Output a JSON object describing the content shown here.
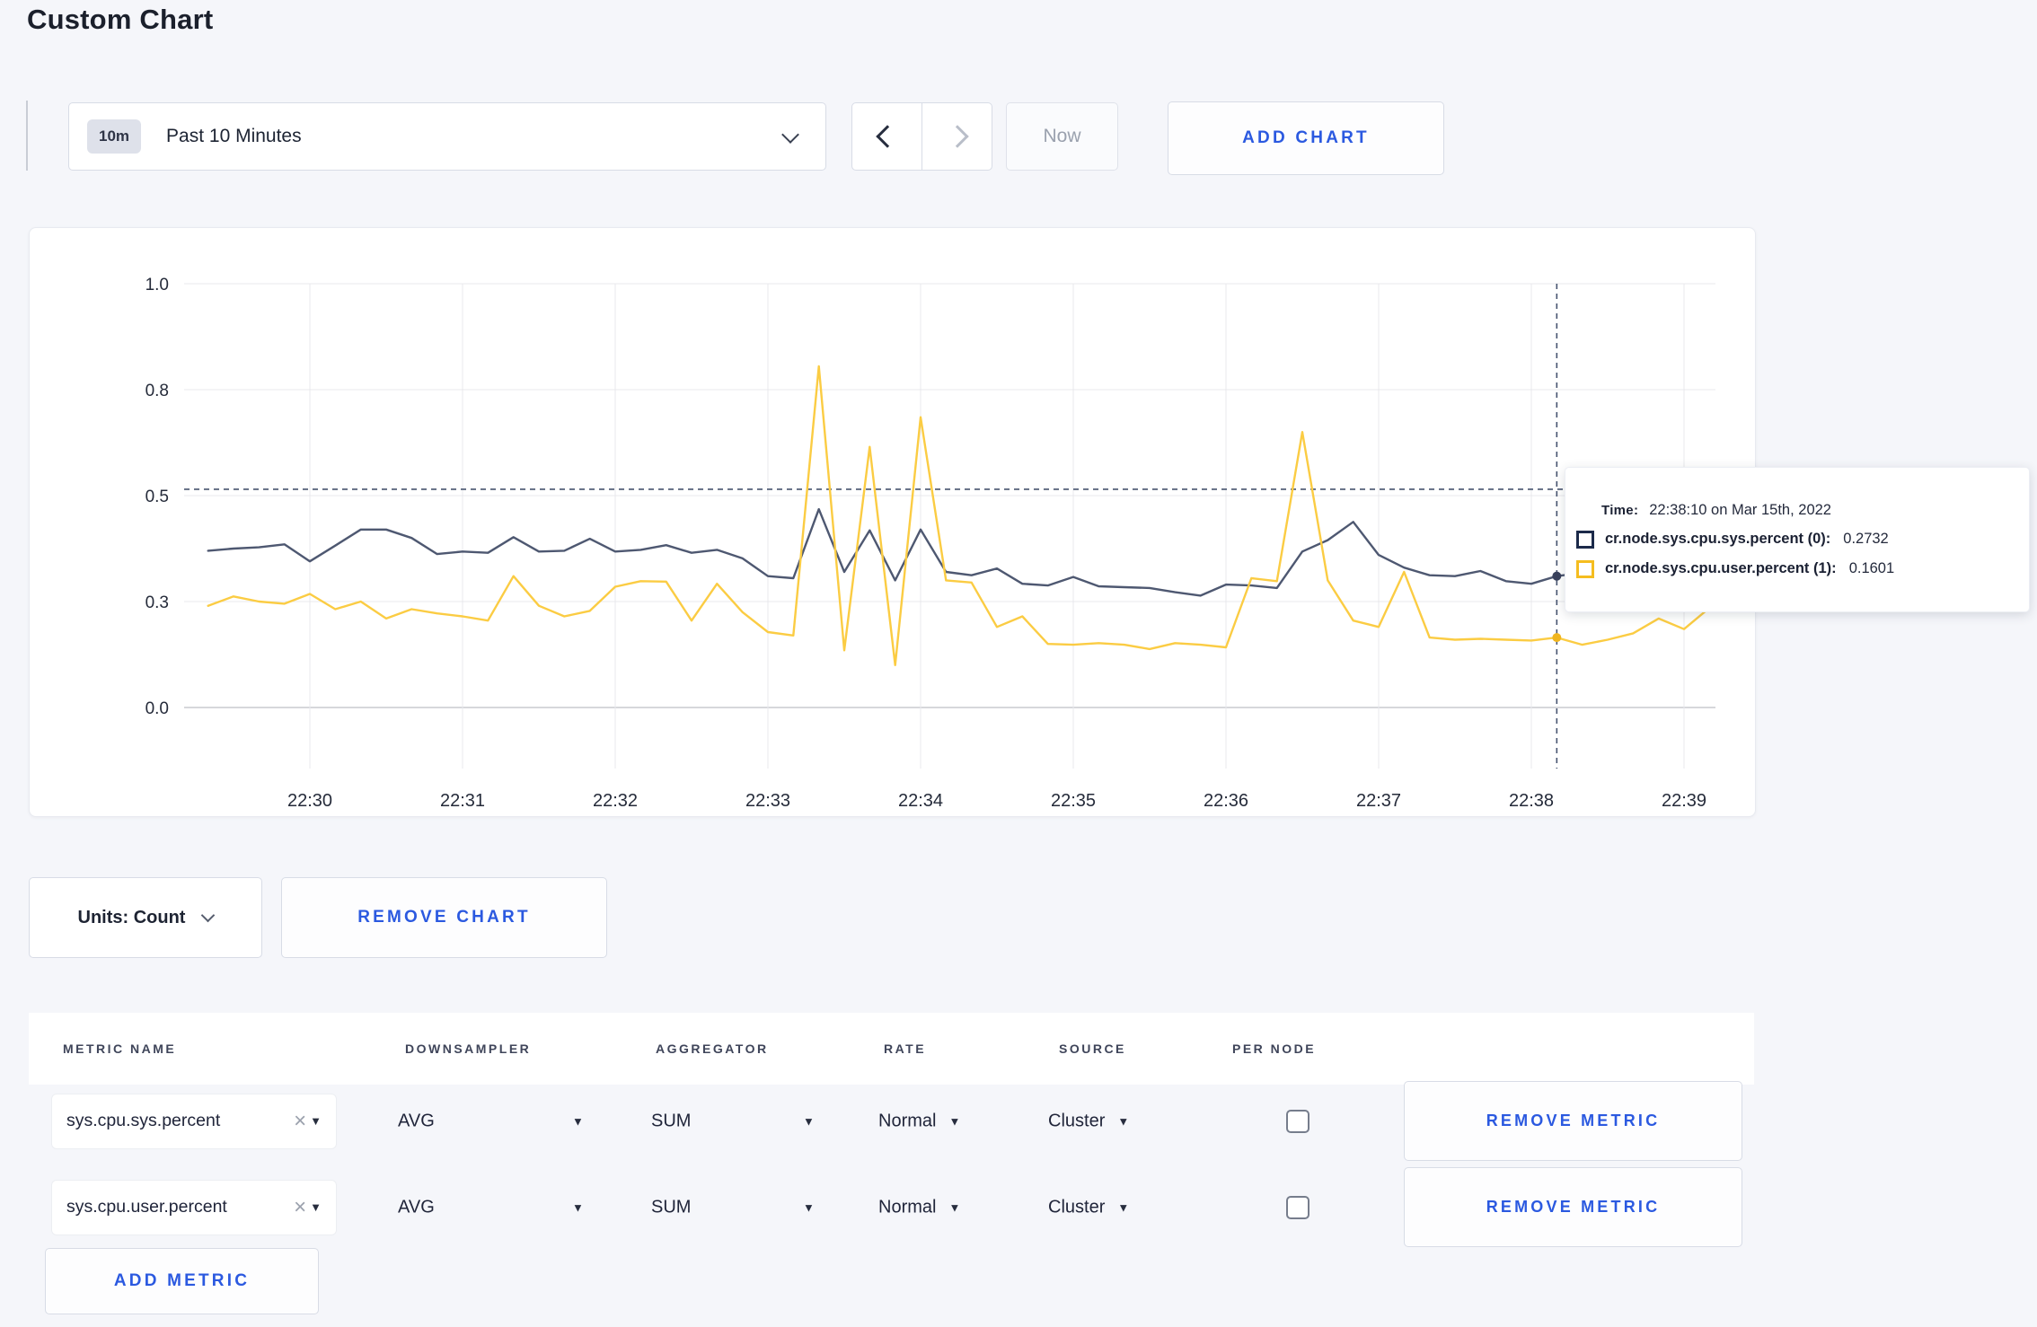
{
  "page": {
    "title": "Custom Chart",
    "accent_blue": "#2b59e0",
    "background": "#f5f6fa"
  },
  "toolbar": {
    "time_badge": "10m",
    "time_label": "Past 10 Minutes",
    "now_label": "Now",
    "add_chart_label": "ADD CHART"
  },
  "tooltip": {
    "time_label": "Time:",
    "time_value": "22:38:10 on Mar 15th, 2022",
    "rows": [
      {
        "label": "cr.node.sys.cpu.sys.percent (0):",
        "value": "0.2732",
        "color": "#1c2a4a"
      },
      {
        "label": "cr.node.sys.cpu.user.percent (1):",
        "value": "0.1601",
        "color": "#f5bd1f"
      }
    ]
  },
  "chart_controls": {
    "units_label": "Units: Count",
    "remove_chart_label": "REMOVE CHART"
  },
  "chart_data": {
    "type": "line",
    "title": "",
    "xlabel": "",
    "ylabel": "",
    "ylim": [
      0,
      1
    ],
    "grid": true,
    "legend_position": "tooltip-only",
    "x_tick_labels": [
      "22:30",
      "22:31",
      "22:32",
      "22:33",
      "22:34",
      "22:35",
      "22:36",
      "22:37",
      "22:38",
      "22:39"
    ],
    "y_tick_labels": [
      "1.0",
      "0.8",
      "0.5",
      "0.3",
      "0.0"
    ],
    "y_tick_values": [
      1.0,
      0.75,
      0.5,
      0.25,
      0.0
    ],
    "x_start_offset_seconds": -40,
    "x_step_seconds": 10,
    "hover": {
      "index": 53,
      "time": "22:38:10",
      "crosshair_y_value": 0.515
    },
    "series": [
      {
        "name": "cr.node.sys.cpu.sys.percent",
        "color": "#4e5871",
        "dot_color": "#39415c",
        "values": [
          0.37,
          0.375,
          0.378,
          0.385,
          0.345,
          0.382,
          0.42,
          0.42,
          0.4,
          0.362,
          0.368,
          0.365,
          0.402,
          0.368,
          0.37,
          0.398,
          0.368,
          0.372,
          0.383,
          0.365,
          0.372,
          0.352,
          0.31,
          0.305,
          0.468,
          0.32,
          0.418,
          0.3,
          0.42,
          0.32,
          0.312,
          0.328,
          0.292,
          0.288,
          0.308,
          0.286,
          0.284,
          0.282,
          0.272,
          0.264,
          0.29,
          0.288,
          0.282,
          0.368,
          0.395,
          0.438,
          0.36,
          0.33,
          0.312,
          0.31,
          0.322,
          0.298,
          0.292,
          0.31,
          0.318,
          0.322,
          0.3,
          0.31,
          0.298,
          0.306
        ]
      },
      {
        "name": "cr.node.sys.cpu.user.percent",
        "color": "#fbcc43",
        "dot_color": "#f0b51e",
        "values": [
          0.24,
          0.262,
          0.25,
          0.245,
          0.268,
          0.232,
          0.25,
          0.21,
          0.232,
          0.222,
          0.215,
          0.205,
          0.31,
          0.24,
          0.215,
          0.228,
          0.285,
          0.298,
          0.297,
          0.205,
          0.292,
          0.225,
          0.178,
          0.17,
          0.805,
          0.135,
          0.615,
          0.1,
          0.685,
          0.3,
          0.295,
          0.19,
          0.215,
          0.15,
          0.148,
          0.152,
          0.148,
          0.138,
          0.152,
          0.148,
          0.142,
          0.305,
          0.298,
          0.65,
          0.3,
          0.205,
          0.19,
          0.32,
          0.165,
          0.16,
          0.162,
          0.16,
          0.158,
          0.165,
          0.148,
          0.16,
          0.175,
          0.21,
          0.185,
          0.235
        ]
      }
    ]
  },
  "table": {
    "headers": [
      "METRIC NAME",
      "DOWNSAMPLER",
      "AGGREGATOR",
      "RATE",
      "SOURCE",
      "PER NODE"
    ],
    "rows": [
      {
        "metric": "sys.cpu.sys.percent",
        "downsampler": "AVG",
        "aggregator": "SUM",
        "rate": "Normal",
        "source": "Cluster",
        "per_node_checked": false,
        "remove_label": "REMOVE METRIC"
      },
      {
        "metric": "sys.cpu.user.percent",
        "downsampler": "AVG",
        "aggregator": "SUM",
        "rate": "Normal",
        "source": "Cluster",
        "per_node_checked": false,
        "remove_label": "REMOVE METRIC"
      }
    ],
    "add_metric_label": "ADD METRIC"
  }
}
